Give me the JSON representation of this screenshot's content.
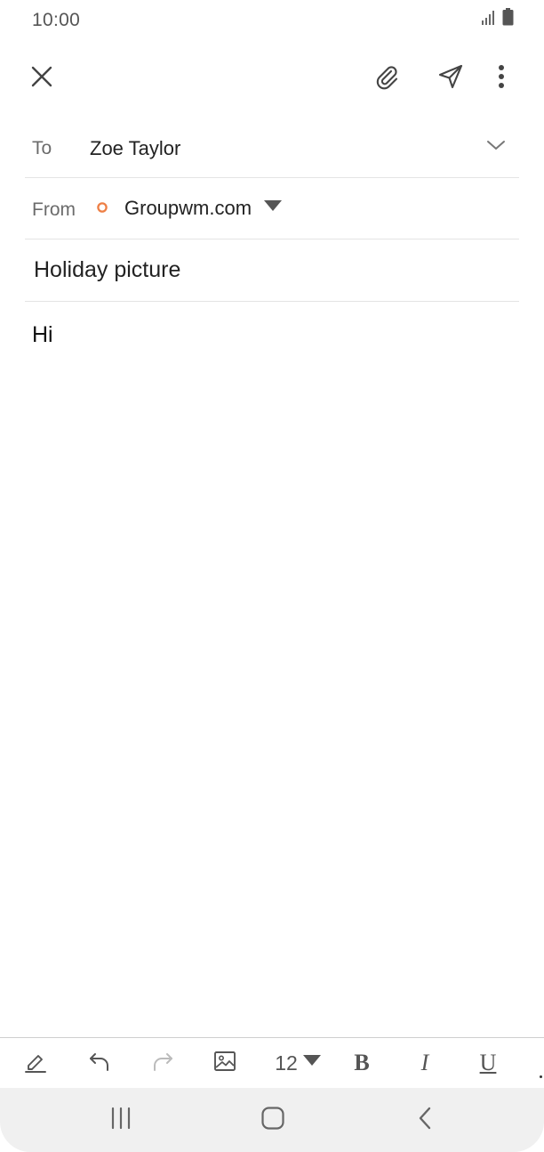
{
  "status_bar": {
    "time": "10:00",
    "icons": [
      "signal-icon",
      "battery-icon"
    ]
  },
  "app_bar": {
    "icons": [
      "close-icon",
      "attachment-icon",
      "send-icon",
      "more-options-icon"
    ]
  },
  "to_field": {
    "label": "To",
    "value": "Zoe Taylor",
    "icon": "chevron-down-icon"
  },
  "from_field": {
    "label": "From",
    "account": "Groupwm.com",
    "account_color": "#ee7f45",
    "icon": "dropdown-triangle-icon"
  },
  "subject": "Holiday picture",
  "body": "Hi",
  "toolbar": {
    "font_size": "12",
    "bold_label": "B",
    "italic_label": "I",
    "underline_label": "U",
    "icons": [
      "handwriting-icon",
      "undo-icon",
      "redo-icon",
      "image-icon"
    ]
  },
  "nav_bar": {
    "icons": [
      "recent-apps-icon",
      "home-icon",
      "back-icon"
    ]
  },
  "colors": {
    "accent": "#ee7f45",
    "divider": "#e4e4e4",
    "icon": "#555555",
    "disabled_icon": "#bbbbbb",
    "nav_background": "#f0f0f0"
  }
}
